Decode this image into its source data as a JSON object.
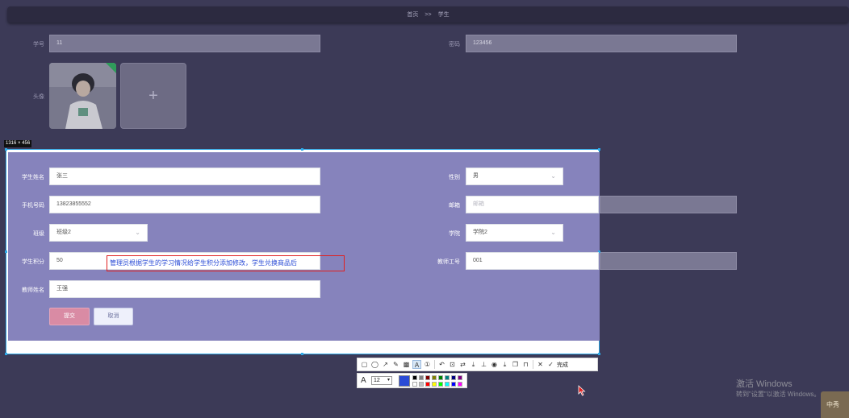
{
  "breadcrumb": {
    "home": "首页",
    "sep": ">>",
    "current": "学生"
  },
  "bg_form": {
    "student_id": {
      "label": "学号",
      "value": "11"
    },
    "password": {
      "label": "密码",
      "value": "123456"
    },
    "avatar": {
      "label": "头像",
      "add_icon": "+"
    }
  },
  "capture": {
    "size_label": "1316 × 456"
  },
  "form": {
    "name": {
      "label": "学生姓名",
      "value": "张三"
    },
    "gender": {
      "label": "性别",
      "value": "男"
    },
    "phone": {
      "label": "手机号码",
      "value": "13823855552"
    },
    "email": {
      "label": "邮箱",
      "placeholder": "邮箱"
    },
    "class": {
      "label": "班级",
      "value": "班级2"
    },
    "college": {
      "label": "学院",
      "value": "学院2"
    },
    "points": {
      "label": "学生积分",
      "value": "50"
    },
    "teacher_no": {
      "label": "教师工号",
      "value": "001"
    },
    "teacher_name": {
      "label": "教师姓名",
      "value": "王强"
    },
    "submit_label": "提交",
    "cancel_label": "取消",
    "annotation_text": "管理员根据学生的学习情况给学生积分添加修改，学生兑换商品后"
  },
  "snip_toolbar": {
    "tools": [
      "rectangle-icon",
      "ellipse-icon",
      "arrow-icon",
      "pen-icon",
      "mosaic-icon",
      "text-icon",
      "serial-number-icon",
      "undo-icon",
      "ocr-icon",
      "translate-icon",
      "scroll-capture-icon",
      "pin-icon",
      "record-icon",
      "download-icon",
      "copy-icon",
      "save-icon",
      "close-icon",
      "check-icon"
    ],
    "done_label": "完成",
    "font_size": "12",
    "current_color": "#2a4bd6",
    "palette": [
      "#000000",
      "#808080",
      "#800000",
      "#808000",
      "#008000",
      "#008080",
      "#000080",
      "#800080",
      "#ffffff",
      "#c0c0c0",
      "#ff0000",
      "#ffff00",
      "#00ff00",
      "#00ffff",
      "#0000ff",
      "#ff00ff"
    ]
  },
  "watermark": {
    "line1": "激活 Windows",
    "line2": "转到\"设置\"以激活 Windows。"
  },
  "corner_badge": {
    "text": "中秀"
  },
  "colors": {
    "page_bg": "#3c3a57",
    "panel_bg": "#8683bc",
    "submit_bg": "#d98ba4",
    "selection_border": "#2ea8e6",
    "annotation_border": "#e02020"
  }
}
